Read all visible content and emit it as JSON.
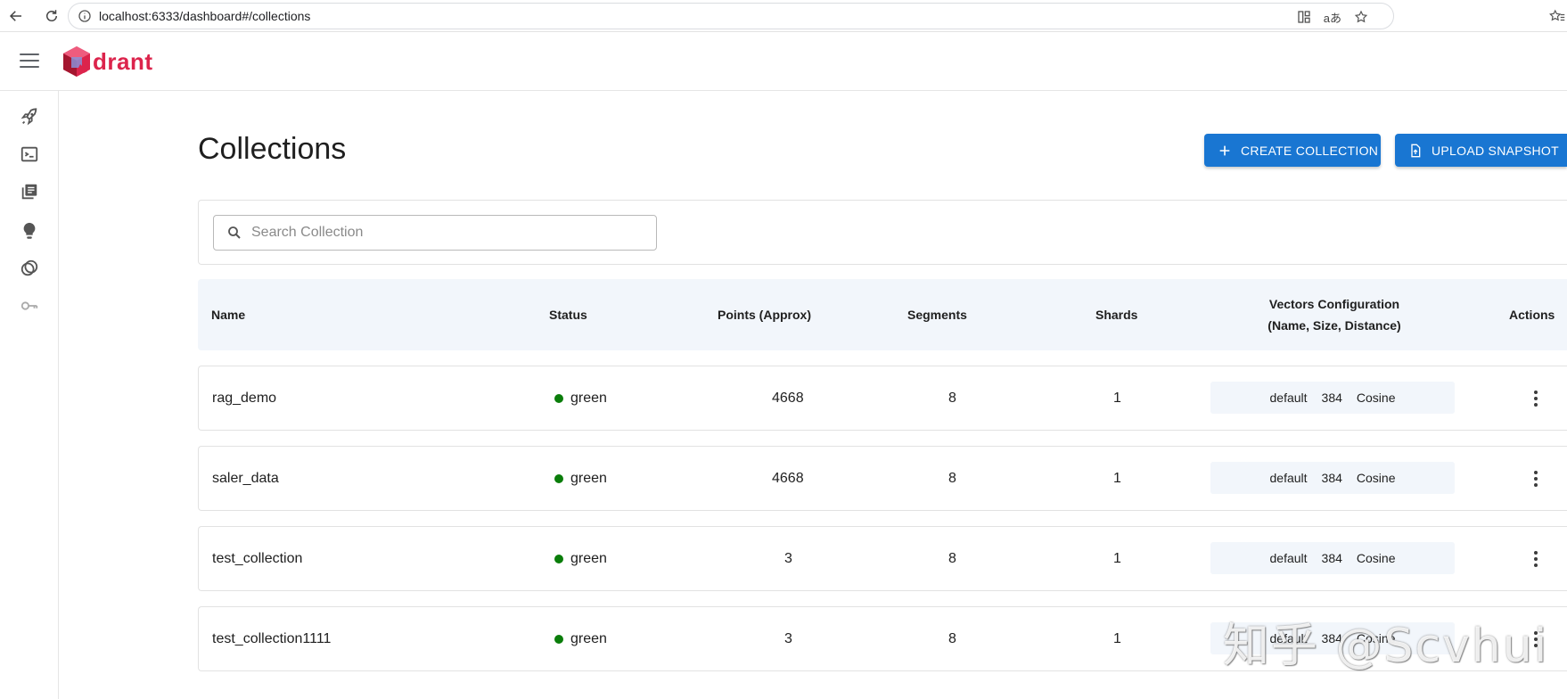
{
  "browser": {
    "url": "localhost:6333/dashboard#/collections",
    "translate_label": "aあ"
  },
  "app": {
    "logo_text": "drant",
    "brand_color": "#dc244c"
  },
  "sidebar": {
    "items": [
      {
        "icon": "rocket-icon"
      },
      {
        "icon": "console-icon"
      },
      {
        "icon": "collections-icon"
      },
      {
        "icon": "lightbulb-icon"
      },
      {
        "icon": "datasets-icon"
      },
      {
        "icon": "key-icon"
      }
    ]
  },
  "main": {
    "title": "Collections",
    "create_label": "CREATE COLLECTION",
    "upload_label": "UPLOAD SNAPSHOT",
    "accent_color": "#1976d2",
    "search": {
      "placeholder": "Search Collection",
      "value": ""
    },
    "table": {
      "headers": {
        "name": "Name",
        "status": "Status",
        "points": "Points (Approx)",
        "segments": "Segments",
        "shards": "Shards",
        "vectors_line1": "Vectors Configuration",
        "vectors_line2": "(Name, Size, Distance)",
        "actions": "Actions"
      },
      "rows": [
        {
          "name": "rag_demo",
          "status": "green",
          "points": "4668",
          "segments": "8",
          "shards": "1",
          "vec_name": "default",
          "vec_size": "384",
          "vec_distance": "Cosine"
        },
        {
          "name": "saler_data",
          "status": "green",
          "points": "4668",
          "segments": "8",
          "shards": "1",
          "vec_name": "default",
          "vec_size": "384",
          "vec_distance": "Cosine"
        },
        {
          "name": "test_collection",
          "status": "green",
          "points": "3",
          "segments": "8",
          "shards": "1",
          "vec_name": "default",
          "vec_size": "384",
          "vec_distance": "Cosine"
        },
        {
          "name": "test_collection1111",
          "status": "green",
          "points": "3",
          "segments": "8",
          "shards": "1",
          "vec_name": "default",
          "vec_size": "384",
          "vec_distance": "Cosine"
        }
      ]
    }
  },
  "watermark": "知乎 @Scvhui"
}
